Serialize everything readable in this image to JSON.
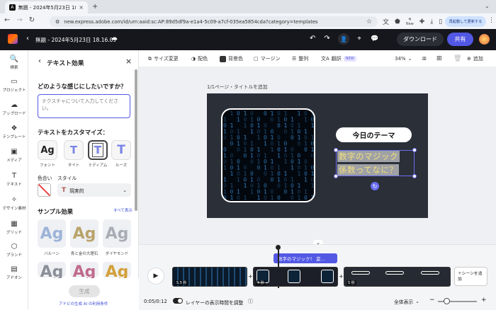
{
  "browser": {
    "tab_title": "無題 - 2024年5月23日 18.16.0",
    "url": "new.express.adobe.com/id/urn:aaid:sc:AP:89d5df9a-e1a4-5c09-a7cf-035ea5854cda?category=templates",
    "relaunch_label": "再起動して更新する",
    "new_badge": "New"
  },
  "header": {
    "doc_title": "無題 - 2024年5月23日 18.16.09",
    "download": "ダウンロード",
    "share": "共有"
  },
  "rail": [
    {
      "label": "検索",
      "icon": "🔍"
    },
    {
      "label": "プロジェクト",
      "icon": "▭"
    },
    {
      "label": "アップロード",
      "icon": "☁"
    },
    {
      "label": "テンプレート",
      "icon": "❖"
    },
    {
      "label": "メディア",
      "icon": "▣"
    },
    {
      "label": "テキスト",
      "icon": "T"
    },
    {
      "label": "デザイン素材",
      "icon": "✧"
    },
    {
      "label": "グリッド",
      "icon": "▦"
    },
    {
      "label": "ブランド",
      "icon": "⬡"
    },
    {
      "label": "アドオン",
      "icon": "▤"
    }
  ],
  "panel": {
    "title": "テキスト効果",
    "question": "どのような感じにしたいですか？",
    "textarea_placeholder": "テクスチャについて入力してください。",
    "customize_title": "テキストをカスタマイズ：",
    "custom_items": [
      "フォント",
      "タイト",
      "ミディアム",
      "ルーズ"
    ],
    "color_label": "色合い",
    "style_label": "スタイル",
    "style_value": "現実的",
    "samples_title": "サンプル効果",
    "see_all": "すべて表示",
    "samples": [
      "バルーン",
      "青と金の大理石",
      "ダイヤモンド"
    ],
    "generate": "生成",
    "terms": "アドビの生成 AI の利用条件"
  },
  "toolbar": {
    "resize": "サイズ変更",
    "color": "配色",
    "bg_color": "背景色",
    "margin": "マージン",
    "arrange": "整列",
    "translate": "翻訳",
    "new_tag": "NEW",
    "zoom": "34%",
    "add": "追加"
  },
  "canvas": {
    "page_label": "1/1ページ・タイトルを追加",
    "theme_title": "今日のテーマ",
    "line1": "数字のマジック",
    "line2": "係数ってなに？"
  },
  "timeline": {
    "layer_label": "数字のマジック！ 変...",
    "clip1_time": "5.5 秒",
    "clip2_time": "4 秒",
    "clip3_time": "5 秒",
    "add_scene": "＋シーンを追加",
    "time": "0:05/0:12",
    "layer_toggle": "レイヤーの表示時間を調整",
    "view_all": "全体表示"
  }
}
